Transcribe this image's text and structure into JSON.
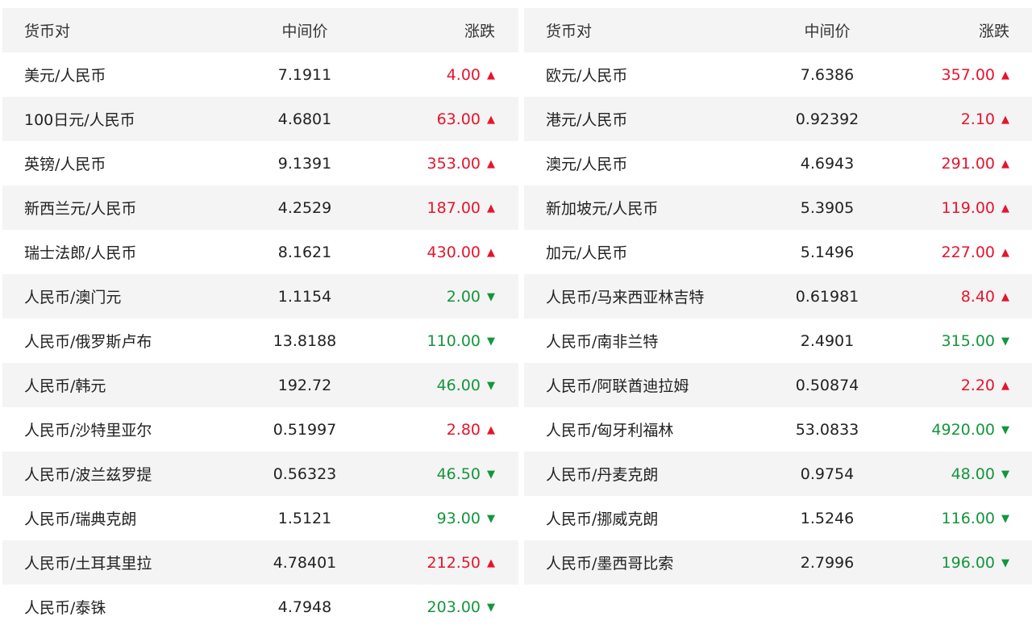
{
  "headers": {
    "pair": "货币对",
    "mid": "中间价",
    "change": "涨跌"
  },
  "colors": {
    "up": "#e6142d",
    "down": "#14963c",
    "row_shade": "#f4f4f4"
  },
  "icons": {
    "up": "triangle-up-icon",
    "down": "triangle-down-icon"
  },
  "left": [
    {
      "pair": "美元/人民币",
      "mid": "7.1911",
      "change": "4.00",
      "dir": "up"
    },
    {
      "pair": "100日元/人民币",
      "mid": "4.6801",
      "change": "63.00",
      "dir": "up"
    },
    {
      "pair": "英镑/人民币",
      "mid": "9.1391",
      "change": "353.00",
      "dir": "up"
    },
    {
      "pair": "新西兰元/人民币",
      "mid": "4.2529",
      "change": "187.00",
      "dir": "up"
    },
    {
      "pair": "瑞士法郎/人民币",
      "mid": "8.1621",
      "change": "430.00",
      "dir": "up"
    },
    {
      "pair": "人民币/澳门元",
      "mid": "1.1154",
      "change": "2.00",
      "dir": "down"
    },
    {
      "pair": "人民币/俄罗斯卢布",
      "mid": "13.8188",
      "change": "110.00",
      "dir": "down"
    },
    {
      "pair": "人民币/韩元",
      "mid": "192.72",
      "change": "46.00",
      "dir": "down"
    },
    {
      "pair": "人民币/沙特里亚尔",
      "mid": "0.51997",
      "change": "2.80",
      "dir": "up"
    },
    {
      "pair": "人民币/波兰兹罗提",
      "mid": "0.56323",
      "change": "46.50",
      "dir": "down"
    },
    {
      "pair": "人民币/瑞典克朗",
      "mid": "1.5121",
      "change": "93.00",
      "dir": "down"
    },
    {
      "pair": "人民币/土耳其里拉",
      "mid": "4.78401",
      "change": "212.50",
      "dir": "up"
    },
    {
      "pair": "人民币/泰铢",
      "mid": "4.7948",
      "change": "203.00",
      "dir": "down"
    }
  ],
  "right": [
    {
      "pair": "欧元/人民币",
      "mid": "7.6386",
      "change": "357.00",
      "dir": "up"
    },
    {
      "pair": "港元/人民币",
      "mid": "0.92392",
      "change": "2.10",
      "dir": "up"
    },
    {
      "pair": "澳元/人民币",
      "mid": "4.6943",
      "change": "291.00",
      "dir": "up"
    },
    {
      "pair": "新加坡元/人民币",
      "mid": "5.3905",
      "change": "119.00",
      "dir": "up"
    },
    {
      "pair": "加元/人民币",
      "mid": "5.1496",
      "change": "227.00",
      "dir": "up"
    },
    {
      "pair": "人民币/马来西亚林吉特",
      "mid": "0.61981",
      "change": "8.40",
      "dir": "up"
    },
    {
      "pair": "人民币/南非兰特",
      "mid": "2.4901",
      "change": "315.00",
      "dir": "down"
    },
    {
      "pair": "人民币/阿联酋迪拉姆",
      "mid": "0.50874",
      "change": "2.20",
      "dir": "up"
    },
    {
      "pair": "人民币/匈牙利福林",
      "mid": "53.0833",
      "change": "4920.00",
      "dir": "down"
    },
    {
      "pair": "人民币/丹麦克朗",
      "mid": "0.9754",
      "change": "48.00",
      "dir": "down"
    },
    {
      "pair": "人民币/挪威克朗",
      "mid": "1.5246",
      "change": "116.00",
      "dir": "down"
    },
    {
      "pair": "人民币/墨西哥比索",
      "mid": "2.7996",
      "change": "196.00",
      "dir": "down"
    }
  ]
}
